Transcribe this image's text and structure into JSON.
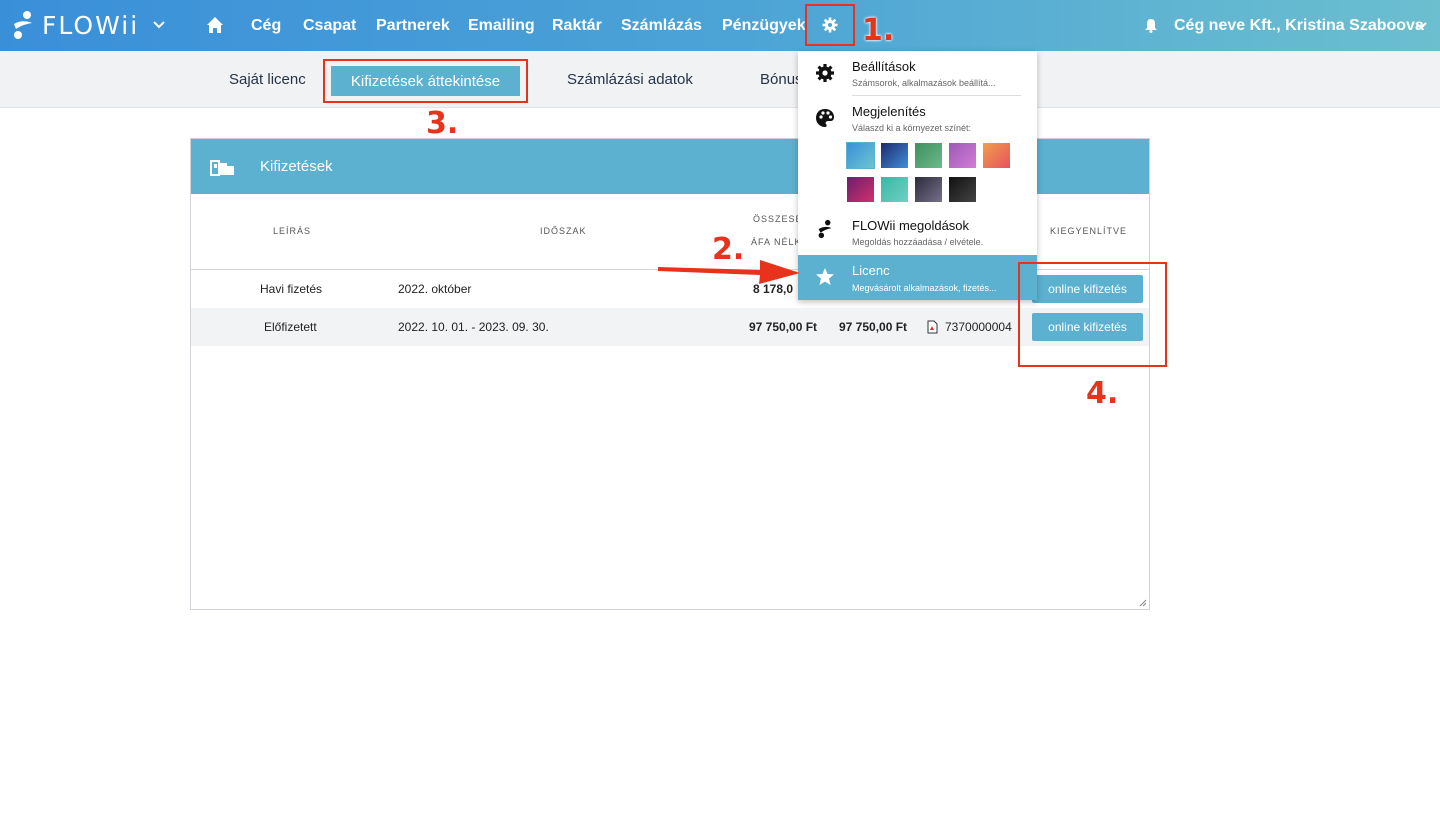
{
  "topbar": {
    "logo_text": "FLOWii",
    "nav": [
      "Cég",
      "Csapat",
      "Partnerek",
      "Emailing",
      "Raktár",
      "Számlázás",
      "Pénzügyek"
    ],
    "company_user": "Cég neve Kft., Kristina Szaboova"
  },
  "subnav": {
    "tabs": [
      "Saját licenc",
      "Kifizetések áttekintése",
      "Számlázási adatok",
      "Bónus"
    ],
    "active": "Kifizetések áttekintése"
  },
  "card": {
    "title": "Kifizetések",
    "headers": {
      "leiras": "LEÍRÁS",
      "idoszak": "IDŐSZAK",
      "osszeg_top": "ÖSSZESE",
      "osszeg_bottom": "ÁFA NÉLK",
      "kiegyenlitve": "KIEGYENLÍTVE"
    },
    "rows": [
      {
        "leiras": "Havi fizetés",
        "idoszak": "2022. október",
        "netto": "8 178,0",
        "brutto": "",
        "szamla": "",
        "button": "online kifizetés"
      },
      {
        "leiras": "Előfizetett",
        "idoszak": "2022. 10. 01. - 2023. 09. 30.",
        "netto": "97 750,00 Ft",
        "brutto": "97 750,00 Ft",
        "szamla": "7370000004",
        "button": "online kifizetés"
      }
    ]
  },
  "dropdown": {
    "items": [
      {
        "title": "Beállítások",
        "sub": "Számsorok, alkalmazások beállítá..."
      },
      {
        "title": "Megjelenítés",
        "sub": "Válaszd ki a környezet színét:"
      },
      {
        "title": "FLOWii megoldások",
        "sub": "Megoldás hozzáadása / elvétele."
      },
      {
        "title": "Licenc",
        "sub": "Megvásárolt alkalmazások, fizetés..."
      }
    ],
    "swatches": [
      [
        "#3a8fd9",
        "#6cc6cf"
      ],
      [
        "#1e2a6e",
        "#3f8fd8"
      ],
      [
        "#3f8f5f",
        "#6cb98a"
      ],
      [
        "#9b59b6",
        "#d47dd6"
      ],
      [
        "#f0a14a",
        "#e8505f"
      ],
      [
        "#6a1f6e",
        "#d2306b"
      ],
      [
        "#3bb7a4",
        "#6fd0c2"
      ],
      [
        "#2c2c3c",
        "#77708a"
      ],
      [
        "#111111",
        "#444444"
      ]
    ]
  },
  "annotations": [
    "1.",
    "2.",
    "3.",
    "4."
  ],
  "colors": {
    "accent": "#5bb1cf",
    "annotation": "#e8331c"
  }
}
